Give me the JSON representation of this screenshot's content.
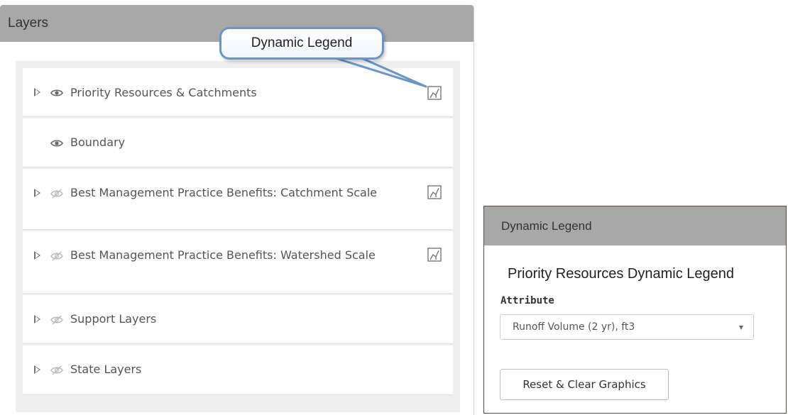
{
  "layers_panel": {
    "title": "Layers",
    "items": [
      {
        "label": "Priority Resources & Catchments",
        "has_caret": true,
        "visible": true,
        "has_legend": true
      },
      {
        "label": "Boundary",
        "has_caret": false,
        "visible": true,
        "has_legend": false
      },
      {
        "label": "Best Management Practice Benefits: Catchment Scale",
        "has_caret": true,
        "visible": false,
        "has_legend": true
      },
      {
        "label": "Best Management Practice Benefits: Watershed Scale",
        "has_caret": true,
        "visible": false,
        "has_legend": true
      },
      {
        "label": "Support Layers",
        "has_caret": true,
        "visible": false,
        "has_legend": false
      },
      {
        "label": "State Layers",
        "has_caret": true,
        "visible": false,
        "has_legend": false
      }
    ]
  },
  "callout": {
    "text": "Dynamic Legend"
  },
  "legend_panel": {
    "title": "Dynamic Legend",
    "heading": "Priority Resources Dynamic Legend",
    "attribute_label": "Attribute",
    "attribute_value": "Runoff Volume (2 yr), ft3",
    "reset_button": "Reset & Clear Graphics"
  },
  "icons": {
    "caret": "caret-right-icon",
    "eye_visible": "eye-icon",
    "eye_hidden": "eye-slash-icon",
    "legend": "dynamic-legend-icon",
    "select_arrow": "chevron-down-icon"
  },
  "colors": {
    "header_bg": "#a8a8a8",
    "panel_body_bg": "#efefef",
    "callout_border": "#6b95c4",
    "text": "#555555"
  }
}
